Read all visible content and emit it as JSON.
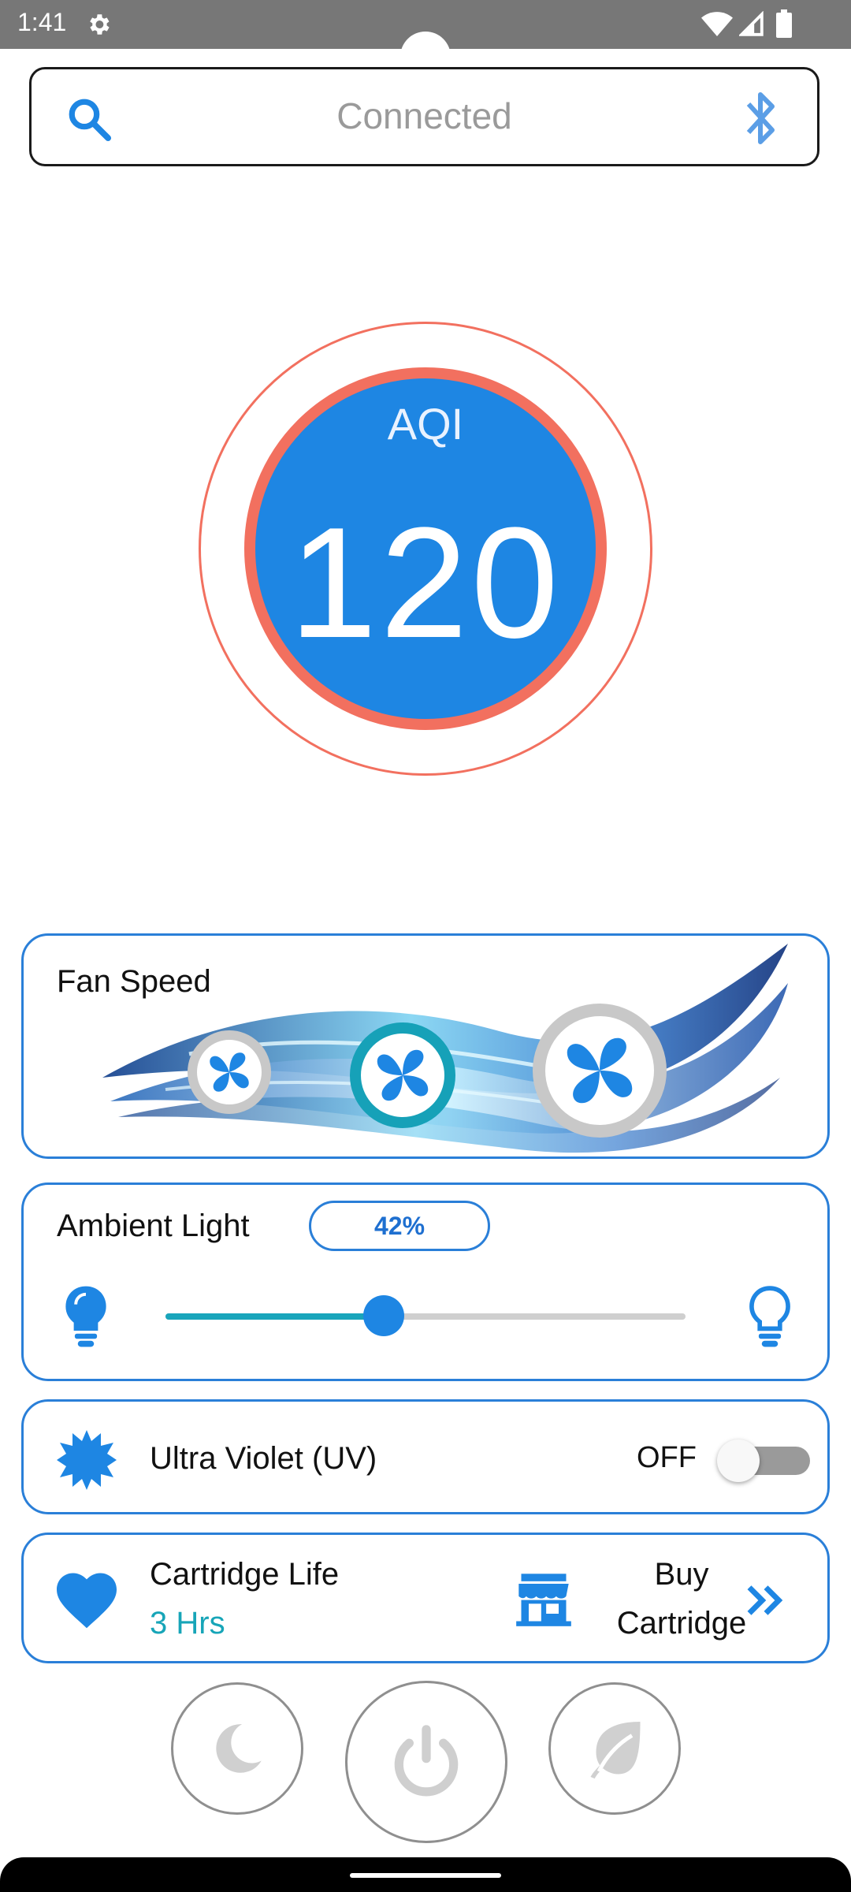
{
  "status_bar": {
    "time": "1:41",
    "icons": [
      "gear-icon",
      "wifi-icon",
      "signal-icon",
      "battery-icon"
    ]
  },
  "connection_bar": {
    "status": "Connected",
    "icons": [
      "search-icon",
      "bluetooth-icon"
    ]
  },
  "aqi": {
    "label": "AQI",
    "value": "120",
    "colors": {
      "ring": "#f2705f",
      "fill": "#1e86e3"
    }
  },
  "fan_speed": {
    "title": "Fan Speed",
    "levels": [
      "low",
      "medium",
      "high"
    ],
    "selected": "medium",
    "colors": {
      "selected_ring": "#16a1b8",
      "ring": "#c8c8c8"
    }
  },
  "ambient_light": {
    "title": "Ambient Light",
    "percent_label": "42%",
    "value": 0.42,
    "icons": [
      "bulb-on-icon",
      "bulb-off-icon"
    ]
  },
  "uv": {
    "label": "Ultra Violet (UV)",
    "state": "OFF",
    "enabled": false
  },
  "cartridge": {
    "label": "Cartridge Life",
    "hours": "3 Hrs",
    "buy_line1": "Buy",
    "buy_line2": "Cartridge",
    "icons": [
      "heart-icon",
      "store-icon",
      "chevron-double-right-icon"
    ]
  },
  "bottom_buttons": [
    "sleep-mode",
    "power",
    "eco-mode"
  ],
  "colors": {
    "accent": "#1e86e3",
    "teal": "#17a5b8",
    "border": "#2a7fd8"
  }
}
